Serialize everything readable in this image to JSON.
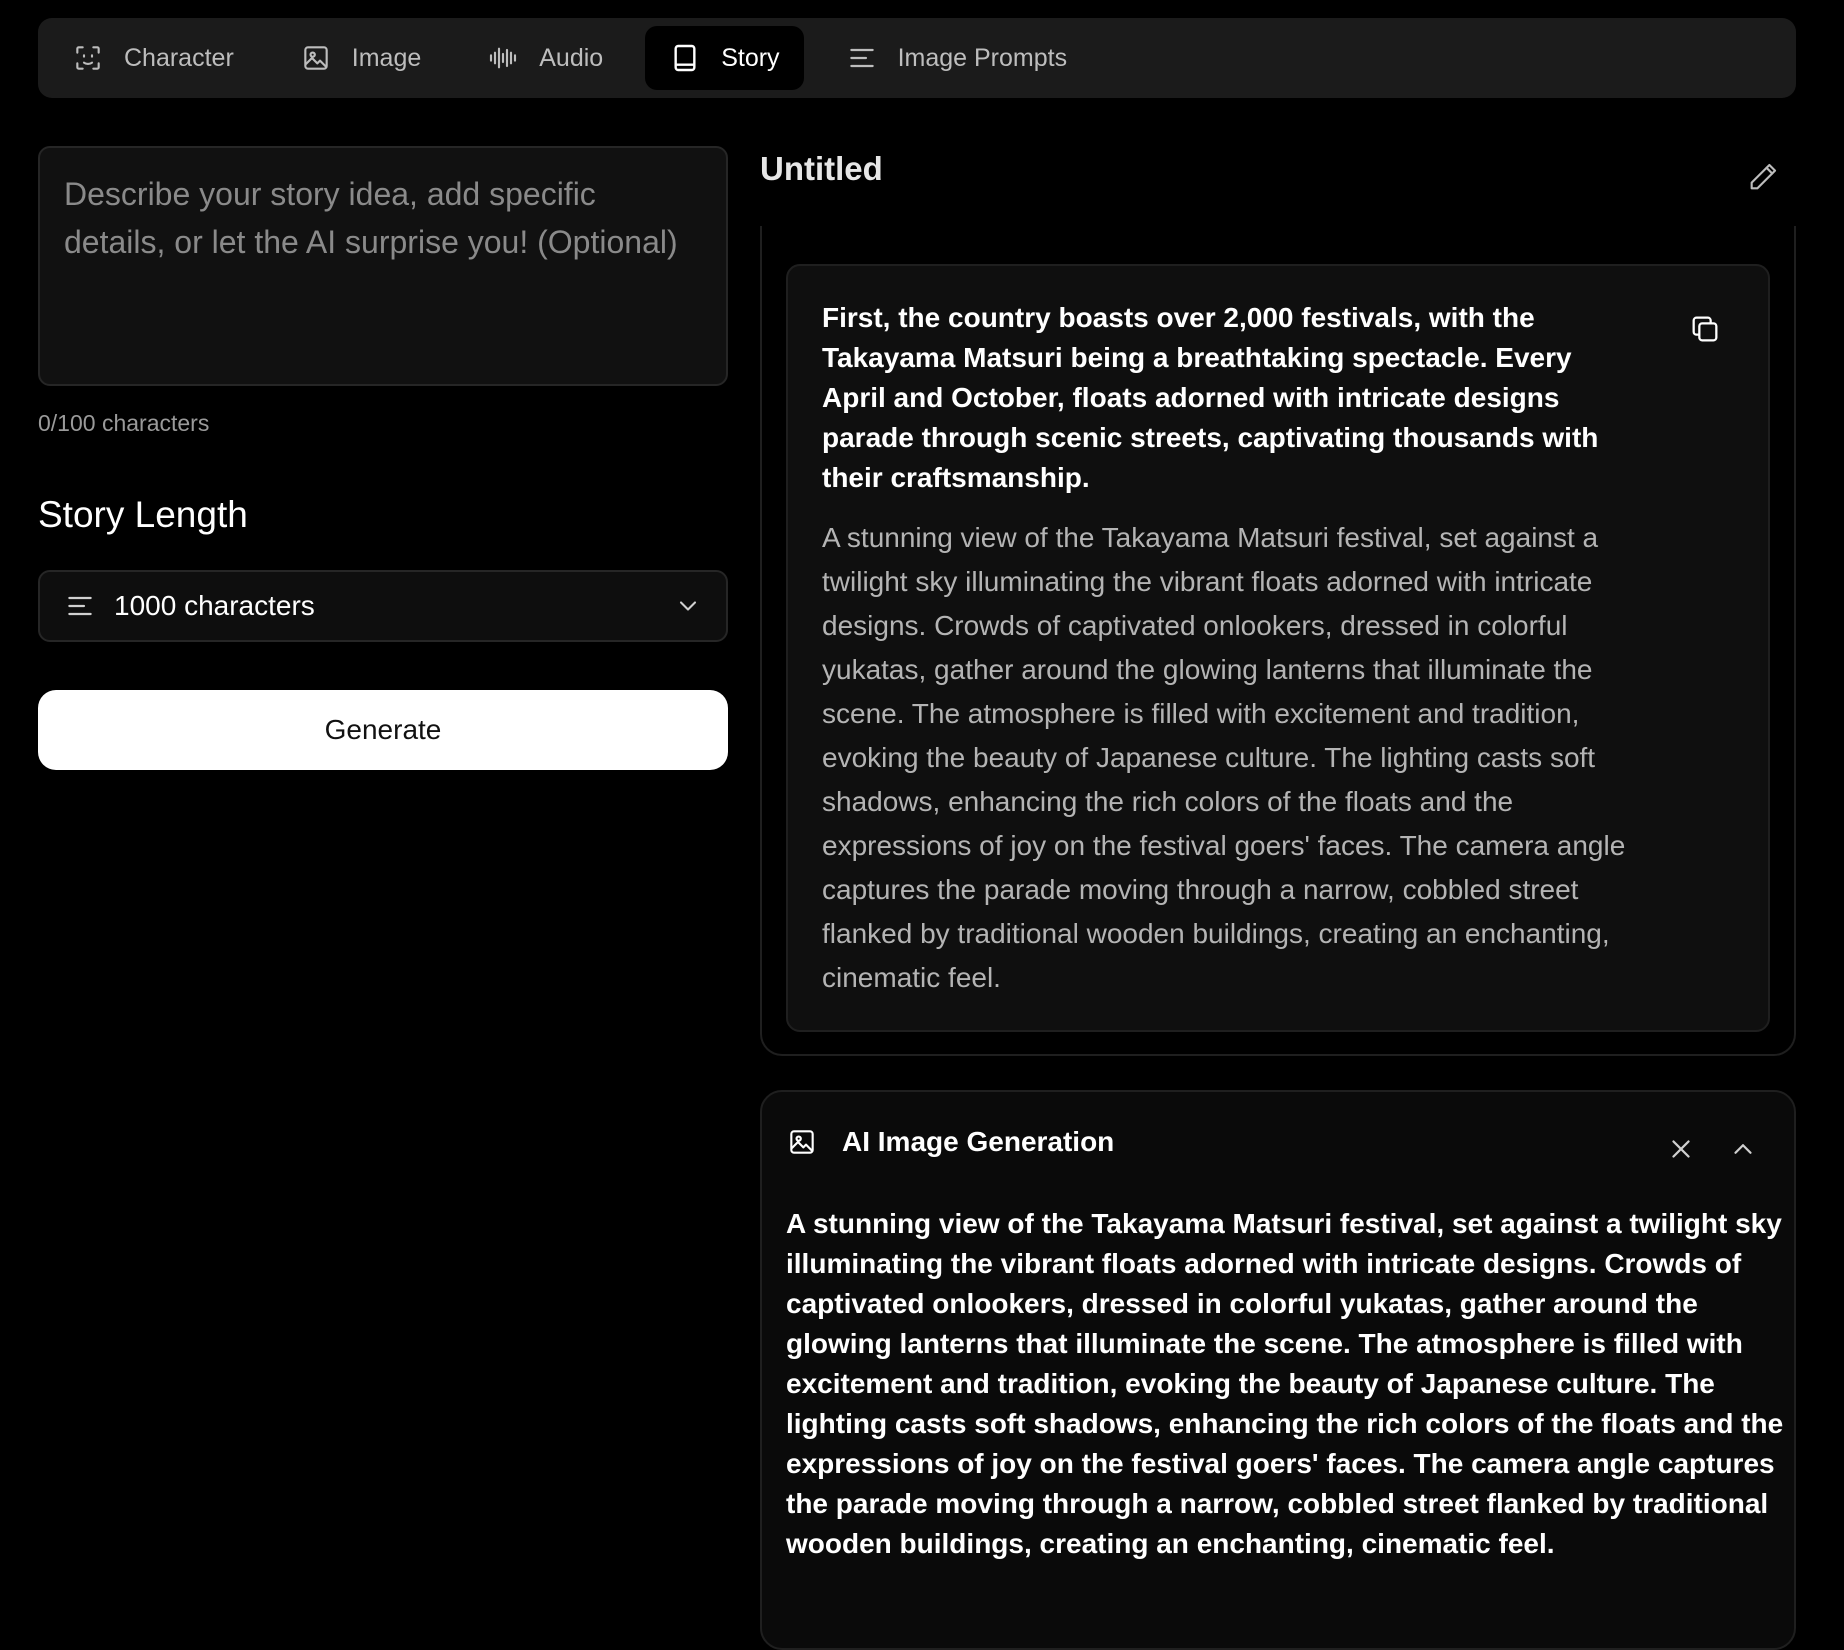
{
  "tabs": [
    {
      "label": "Character",
      "icon": "face-scan-icon",
      "active": false
    },
    {
      "label": "Image",
      "icon": "image-icon",
      "active": false
    },
    {
      "label": "Audio",
      "icon": "audio-waveform-icon",
      "active": false
    },
    {
      "label": "Story",
      "icon": "book-icon",
      "active": true
    },
    {
      "label": "Image Prompts",
      "icon": "text-lines-icon",
      "active": false
    }
  ],
  "left": {
    "prompt_placeholder": "Describe your story idea, add specific details, or let the AI surprise you! (Optional)",
    "prompt_value": "",
    "char_count": "0/100 characters",
    "length_title": "Story Length",
    "length_value": "1000 characters",
    "generate_label": "Generate"
  },
  "story": {
    "title": "Untitled",
    "paragraph": "First, the country boasts over 2,000 festivals, with the Takayama Matsuri being a breathtaking spectacle. Every April and October, floats adorned with intricate designs parade through scenic streets, captivating thousands with their craftsmanship.",
    "image_prompt": "A stunning view of the Takayama Matsuri festival, set against a twilight sky illuminating the vibrant floats adorned with intricate designs. Crowds of captivated onlookers, dressed in colorful yukatas, gather around the glowing lanterns that illuminate the scene. The atmosphere is filled with excitement and tradition, evoking the beauty of Japanese culture. The lighting casts soft shadows, enhancing the rich colors of the floats and the expressions of joy on the festival goers' faces. The camera angle captures the parade moving through a narrow, cobbled street flanked by traditional wooden buildings, creating an enchanting, cinematic feel."
  },
  "ai_image_generation": {
    "title": "AI Image Generation",
    "prompt": "A stunning view of the Takayama Matsuri festival, set against a twilight sky illuminating the vibrant floats adorned with intricate designs. Crowds of captivated onlookers, dressed in colorful yukatas, gather around the glowing lanterns that illuminate the scene. The atmosphere is filled with excitement and tradition, evoking the beauty of Japanese culture. The lighting casts soft shadows, enhancing the rich colors of the floats and the expressions of joy on the festival goers' faces. The camera angle captures the parade moving through a narrow, cobbled street flanked by traditional wooden buildings, creating an enchanting, cinematic feel."
  },
  "colors": {
    "background": "#000000",
    "surface": "#1b1b1b",
    "primary_button": "#ffffff",
    "muted_text": "#b4b4b4"
  }
}
